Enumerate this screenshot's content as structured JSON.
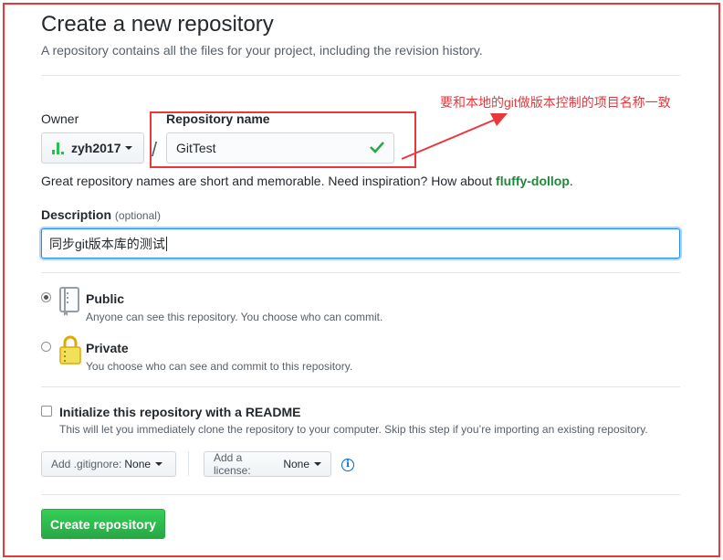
{
  "header": {
    "title": "Create a new repository",
    "subtitle": "A repository contains all the files for your project, including the revision history."
  },
  "owner": {
    "label": "Owner",
    "value": "zyh2017"
  },
  "repository": {
    "label": "Repository name",
    "value": "GitTest",
    "valid_icon": "check-icon",
    "annotation": "要和本地的git做版本控制的项目名称一致"
  },
  "name_hint": {
    "prefix": "Great repository names are short and memorable. Need inspiration? How about ",
    "suggestion": "fluffy-dollop",
    "suffix": "."
  },
  "description": {
    "label": "Description",
    "optional": "(optional)",
    "value": "同步git版本库的测试"
  },
  "visibility": {
    "options": [
      {
        "title": "Public",
        "desc": "Anyone can see this repository. You choose who can commit.",
        "selected": true,
        "icon": "repo-book-icon"
      },
      {
        "title": "Private",
        "desc": "You choose who can see and commit to this repository.",
        "selected": false,
        "icon": "lock-icon"
      }
    ]
  },
  "readme": {
    "title": "Initialize this repository with a README",
    "desc": "This will let you immediately clone the repository to your computer. Skip this step if you’re importing an existing repository.",
    "checked": false
  },
  "gitignore": {
    "label": "Add .gitignore:",
    "value": "None"
  },
  "license": {
    "label": "Add a license:",
    "value": "None"
  },
  "info_icon": "info-icon",
  "submit": {
    "label": "Create repository"
  },
  "colors": {
    "annotation_red": "#e8383b",
    "primary_green": "#28a745",
    "focus_blue": "#2188ff",
    "suggestion_green": "#22863a"
  }
}
